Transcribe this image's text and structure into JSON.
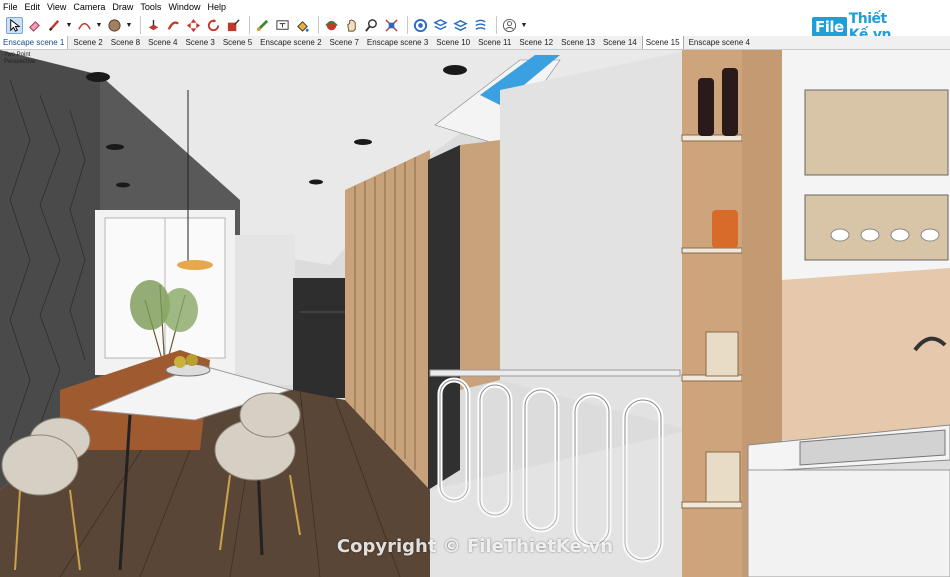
{
  "menu": [
    "File",
    "Edit",
    "View",
    "Camera",
    "Draw",
    "Tools",
    "Window",
    "Help"
  ],
  "toolbar_icons": [
    "select-arrow-icon",
    "eraser-icon",
    "pencil-line-icon",
    "arc-icon",
    "shape-icon",
    "push-pull-icon",
    "follow-me-icon",
    "move-icon",
    "rotate-icon",
    "scale-icon",
    "tape-measure-icon",
    "text-icon",
    "paint-bucket-icon",
    "orbit-icon",
    "pan-icon",
    "zoom-icon",
    "zoom-extents-icon",
    "warehouse-icon",
    "extension-warehouse-icon",
    "layout-icon",
    "account-icon"
  ],
  "scenes": [
    "Enscape scene 1",
    "Scene 2",
    "Scene 8",
    "Scene 4",
    "Scene 3",
    "Scene 5",
    "Enscape scene 2",
    "Scene 7",
    "Enscape scene 3",
    "Scene 10",
    "Scene 11",
    "Scene 12",
    "Scene 13",
    "Scene 14",
    "Scene 15",
    "Enscape scene 4"
  ],
  "active_scene": "Scene 15",
  "logo": {
    "box": "File",
    "text": "Thiết Kế.vn"
  },
  "view": {
    "line1": "Two Point",
    "line2": "Perspective"
  },
  "watermark": "Copyright © FileThietKe.vn",
  "colors": {
    "accent": "#1f9fd6",
    "wall_dark": "#4a4a4a",
    "wood": "#c8a27a",
    "floor": "#5a4636",
    "white_wall": "#e6e6e6"
  }
}
